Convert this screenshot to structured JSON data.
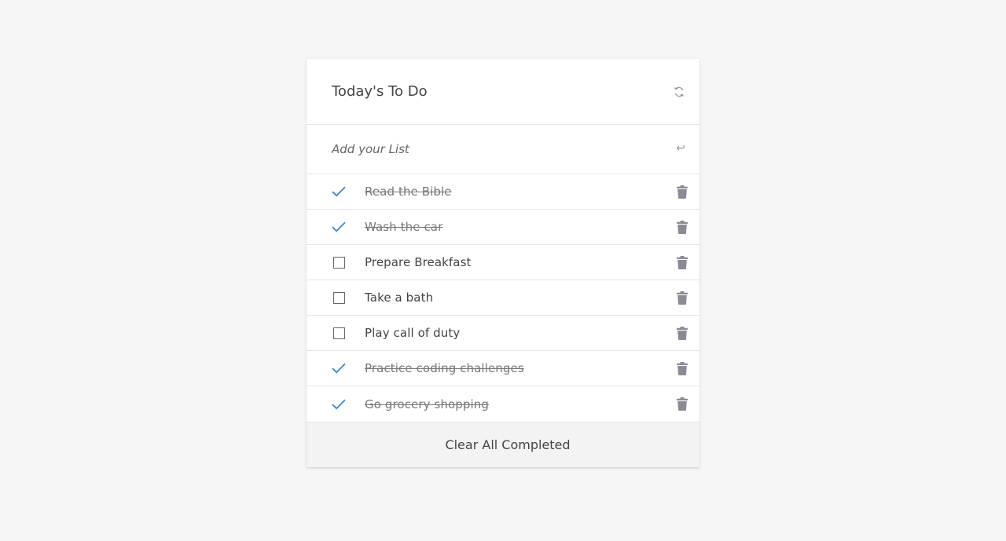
{
  "header": {
    "title": "Today's To Do",
    "refresh_icon": "refresh-icon"
  },
  "add": {
    "placeholder": "Add your List",
    "value": "",
    "submit_icon": "enter-icon",
    "submit_glyph": "↩"
  },
  "todos": [
    {
      "label": "Read the Bible",
      "completed": true
    },
    {
      "label": "Wash the car",
      "completed": true
    },
    {
      "label": "Prepare Breakfast",
      "completed": false
    },
    {
      "label": "Take a bath",
      "completed": false
    },
    {
      "label": "Play call of duty",
      "completed": false
    },
    {
      "label": "Practice coding challenges",
      "completed": true
    },
    {
      "label": "Go grocery shopping",
      "completed": true
    }
  ],
  "footer": {
    "clear_label": "Clear All Completed"
  },
  "colors": {
    "background": "#f5f5f5",
    "card": "#ffffff",
    "check_accent": "#3b86d6",
    "trash_icon": "#8c8a96",
    "footer_bg": "#f3f3f3"
  }
}
